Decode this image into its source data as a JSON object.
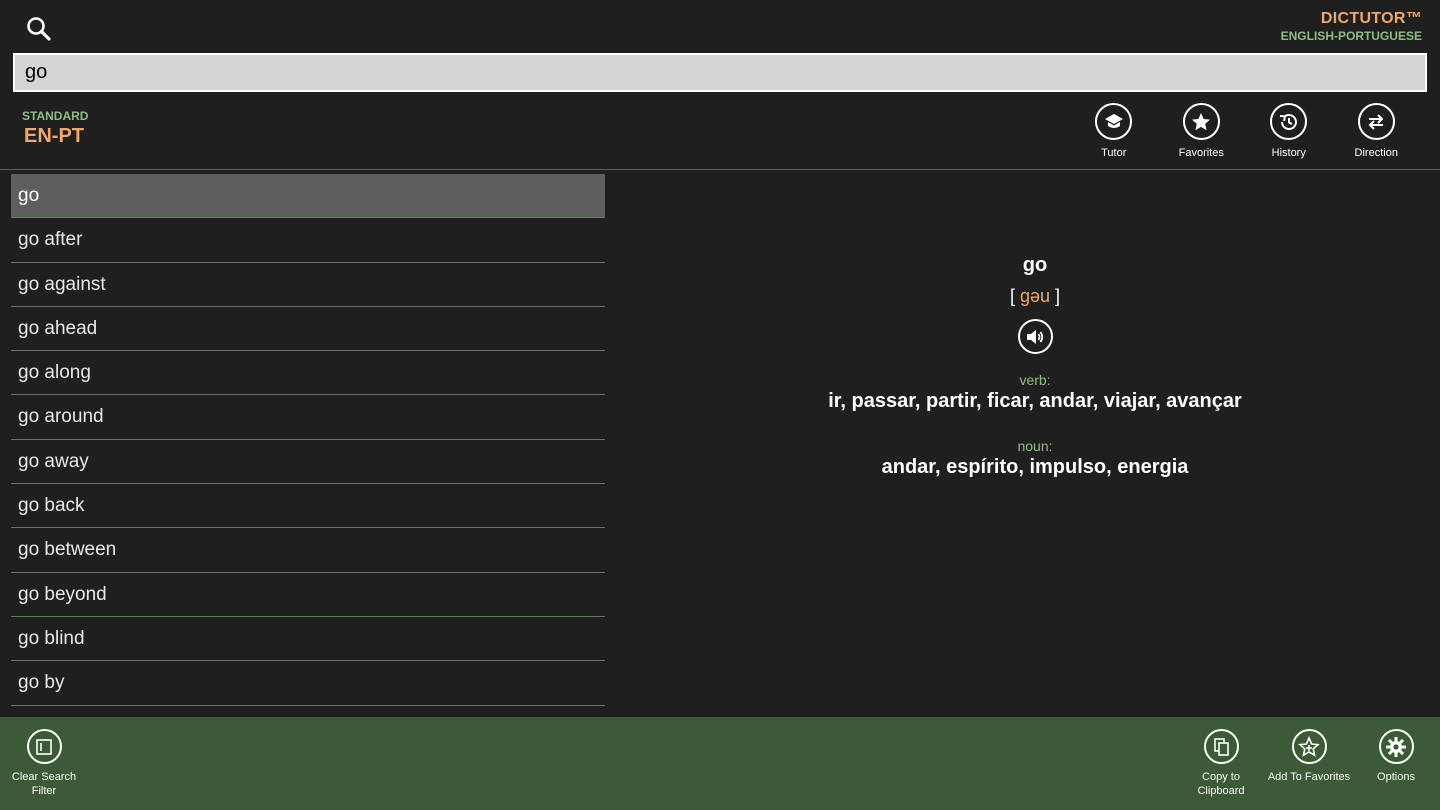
{
  "app": {
    "title": "DICTUTOR™",
    "subtitle": "ENGLISH-PORTUGUESE"
  },
  "search": {
    "value": "go",
    "icon": "search-icon"
  },
  "mode": {
    "label": "STANDARD",
    "value": "EN-PT"
  },
  "toolbar": {
    "tutor_label": "Tutor",
    "favorites_label": "Favorites",
    "history_label": "History",
    "direction_label": "Direction"
  },
  "word_list": {
    "selected_index": 0,
    "items": [
      {
        "label": "go"
      },
      {
        "label": "go after"
      },
      {
        "label": "go against"
      },
      {
        "label": "go ahead"
      },
      {
        "label": "go along"
      },
      {
        "label": "go around"
      },
      {
        "label": "go away"
      },
      {
        "label": "go back"
      },
      {
        "label": "go between"
      },
      {
        "label": "go beyond"
      },
      {
        "label": "go blind"
      },
      {
        "label": "go by"
      }
    ]
  },
  "definition": {
    "word": "go",
    "phonetic_open": "[ ",
    "phonetic": "gəu",
    "phonetic_close": " ]",
    "entries": [
      {
        "pos": "verb:",
        "translations": "ir, passar, partir, ficar, andar, viajar, avançar"
      },
      {
        "pos": "noun:",
        "translations": "andar, espírito, impulso, energia"
      }
    ]
  },
  "appbar": {
    "clear_label_line1": "Clear Search",
    "clear_label_line2": "Filter",
    "copy_label_line1": "Copy to",
    "copy_label_line2": "Clipboard",
    "add_fav_label": "Add To Favorites",
    "options_label": "Options"
  },
  "colors": {
    "background": "#1f1f1f",
    "accent_orange": "#f0a868",
    "accent_green": "#8fbf7f",
    "appbar_green": "#3c5a35",
    "selected_row": "#5e5e5e"
  }
}
